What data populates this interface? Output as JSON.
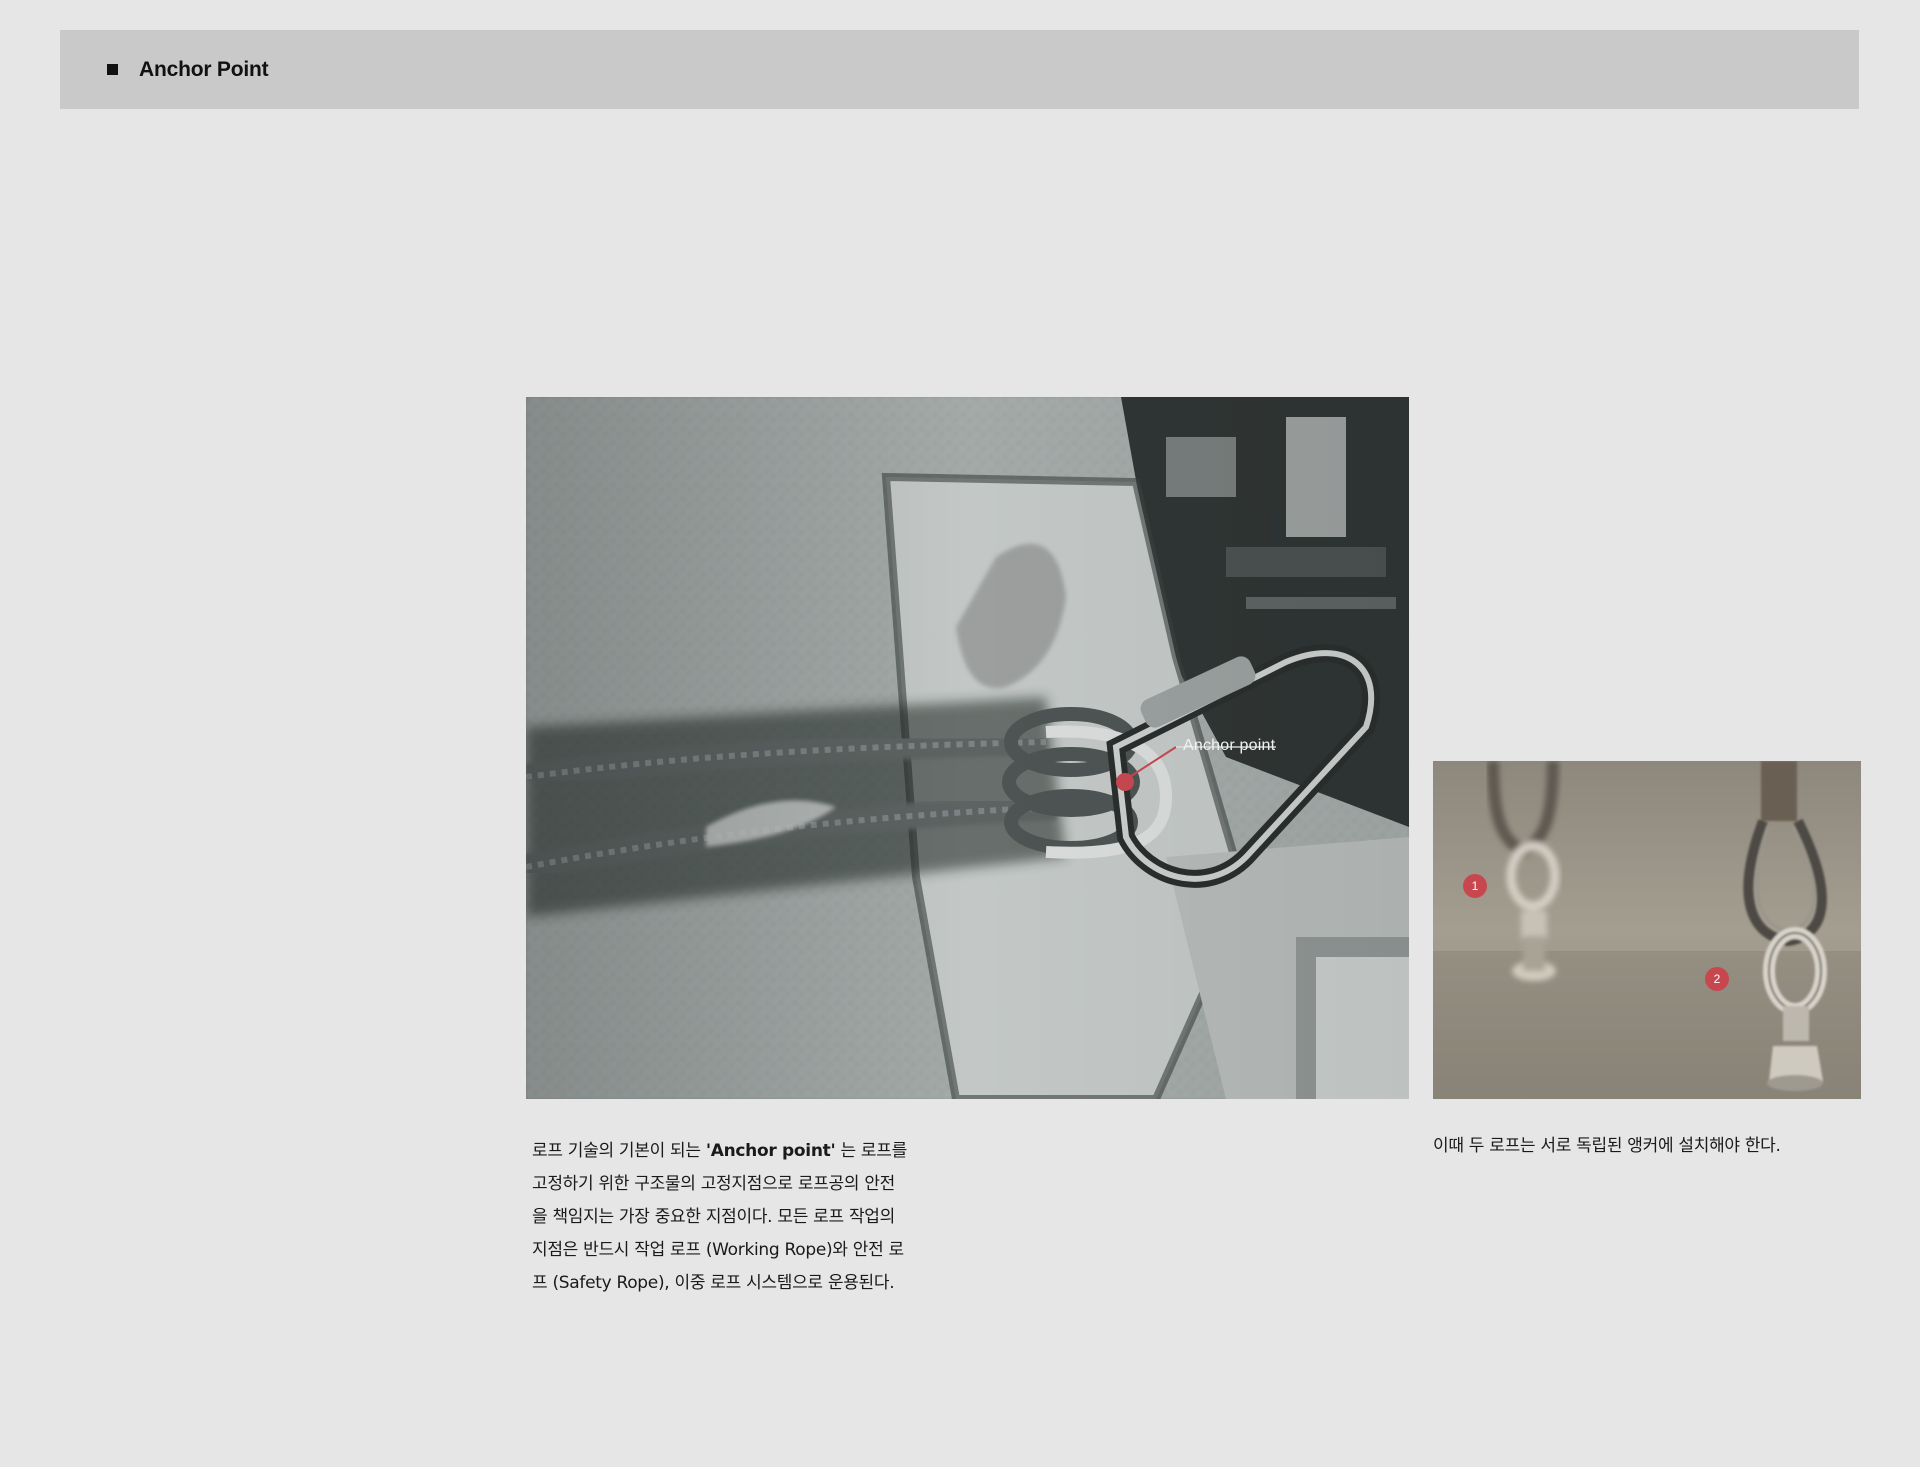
{
  "header": {
    "title": "Anchor Point"
  },
  "main_photo": {
    "annotation_label": "Anchor point",
    "marker_color": "#c8474f"
  },
  "side_photo": {
    "markers": [
      "1",
      "2"
    ],
    "caption": "이때 두 로프는 서로 독립된 앵커에 설치해야 한다."
  },
  "body": {
    "line1_pre": "로프 기술의 기본이 되는 ",
    "line1_bold": "'Anchor point'",
    "line1_post": " 는 로프를",
    "line2": "고정하기 위한 구조물의 고정지점으로 로프공의 안전",
    "line3": "을 책임지는 가장 중요한 지점이다. 모든 로프 작업의",
    "line4": "지점은 반드시 작업 로프 (Working Rope)와 안전 로",
    "line5": "프 (Safety Rope), 이중 로프 시스템으로 운용된다."
  },
  "colors": {
    "background": "#e6e6e6",
    "header_bar": "#c9c9c9",
    "accent_red": "#c8474f"
  }
}
